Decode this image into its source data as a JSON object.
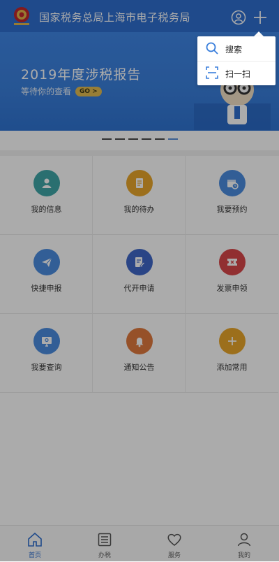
{
  "header": {
    "title": "国家税务总局上海市电子税务局"
  },
  "banner": {
    "title": "2019年度涉税报告",
    "subtitle": "等待你的查看",
    "go_label": "GO >"
  },
  "carousel": {
    "count": 6,
    "active_index": 5
  },
  "grid": [
    {
      "label": "我的信息",
      "icon": "user-card-icon",
      "color": "#3fa6a8"
    },
    {
      "label": "我的待办",
      "icon": "document-icon",
      "color": "#e9a62a"
    },
    {
      "label": "我要预约",
      "icon": "calendar-clock-icon",
      "color": "#4b8de0"
    },
    {
      "label": "快捷申报",
      "icon": "paper-plane-icon",
      "color": "#4b8de0"
    },
    {
      "label": "代开申请",
      "icon": "edit-doc-icon",
      "color": "#3f67c8"
    },
    {
      "label": "发票申领",
      "icon": "ticket-icon",
      "color": "#d9474a"
    },
    {
      "label": "我要查询",
      "icon": "monitor-icon",
      "color": "#4b8de0"
    },
    {
      "label": "通知公告",
      "icon": "bell-icon",
      "color": "#e07a3e"
    },
    {
      "label": "添加常用",
      "icon": "plus-icon",
      "color": "#e9a62a"
    }
  ],
  "menu": {
    "items": [
      {
        "label": "搜索",
        "icon": "search-icon"
      },
      {
        "label": "扫一扫",
        "icon": "scan-icon"
      }
    ]
  },
  "bottom_nav": {
    "items": [
      {
        "label": "首页",
        "icon": "home-icon"
      },
      {
        "label": "办税",
        "icon": "list-icon"
      },
      {
        "label": "服务",
        "icon": "heart-icon"
      },
      {
        "label": "我的",
        "icon": "person-icon"
      }
    ],
    "active_index": 0
  },
  "colors": {
    "brand": "#2f6fcf",
    "overlay": "rgba(0,0,0,0.33)"
  }
}
